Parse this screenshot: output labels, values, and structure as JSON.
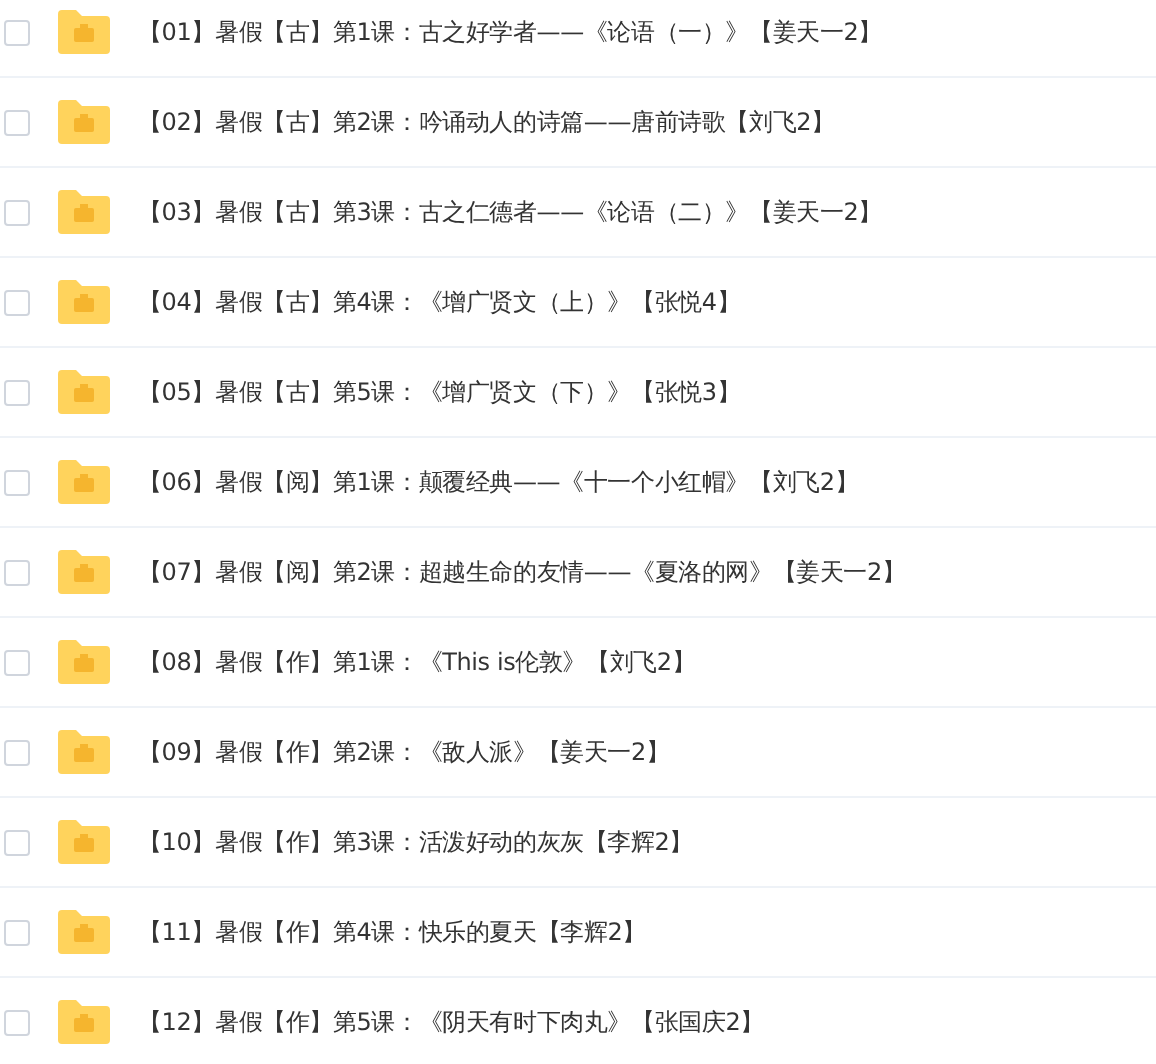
{
  "files": [
    {
      "name": "【01】暑假【古】第1课：古之好学者——《论语（一）》【姜天一2】",
      "checked": false
    },
    {
      "name": "【02】暑假【古】第2课：吟诵动人的诗篇——唐前诗歌【刘飞2】",
      "checked": false
    },
    {
      "name": "【03】暑假【古】第3课：古之仁德者——《论语（二）》【姜天一2】",
      "checked": false
    },
    {
      "name": "【04】暑假【古】第4课：《增广贤文（上）》【张悦4】",
      "checked": false
    },
    {
      "name": "【05】暑假【古】第5课：《增广贤文（下）》【张悦3】",
      "checked": false
    },
    {
      "name": "【06】暑假【阅】第1课：颠覆经典——《十一个小红帽》【刘飞2】",
      "checked": false
    },
    {
      "name": "【07】暑假【阅】第2课：超越生命的友情——《夏洛的网》【姜天一2】",
      "checked": false
    },
    {
      "name": "【08】暑假【作】第1课：《This is伦敦》【刘飞2】",
      "checked": false
    },
    {
      "name": "【09】暑假【作】第2课：《敌人派》【姜天一2】",
      "checked": false
    },
    {
      "name": "【10】暑假【作】第3课：活泼好动的灰灰【李辉2】",
      "checked": false
    },
    {
      "name": "【11】暑假【作】第4课：快乐的夏天【李辉2】",
      "checked": false
    },
    {
      "name": "【12】暑假【作】第5课：《阴天有时下肉丸》【张国庆2】",
      "checked": false
    }
  ]
}
